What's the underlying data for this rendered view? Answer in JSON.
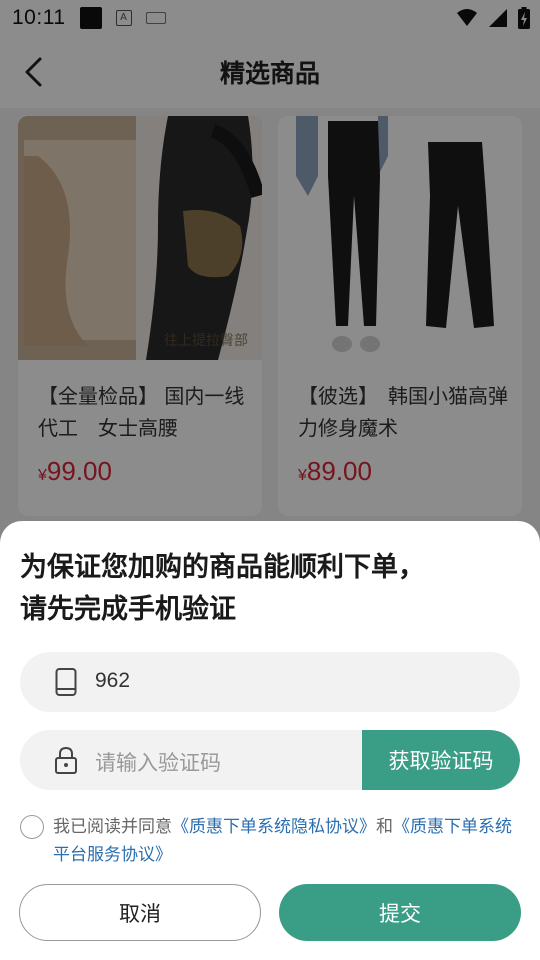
{
  "status_bar": {
    "time": "10:11",
    "a_icon": "A"
  },
  "header": {
    "title": "精选商品",
    "back_icon": "chevron-left-icon"
  },
  "products": [
    {
      "name": "【全量检品】 国内一线代工　女士高腰",
      "price_symbol": "¥",
      "price": "99.00",
      "image_caption": "往上提拉臀部"
    },
    {
      "name": "【彼选】　韩国小猫高弹力修身魔术",
      "price_symbol": "¥",
      "price": "89.00"
    }
  ],
  "dialog": {
    "heading_line1": "为保证您加购的商品能顺利下单，",
    "heading_line2": "请先完成手机验证",
    "phone_value": "962",
    "code_placeholder": "请输入验证码",
    "get_code_label": "获取验证码",
    "agree_prefix": "我已阅读并同意",
    "privacy_link": "《质惠下单系统隐私协议》",
    "agree_and": "和",
    "service_link": "《质惠下单系统平台服务协议》",
    "cancel_label": "取消",
    "submit_label": "提交"
  },
  "colors": {
    "accent": "#3a9e87",
    "price": "#d8263b",
    "link": "#2b6fb0"
  }
}
